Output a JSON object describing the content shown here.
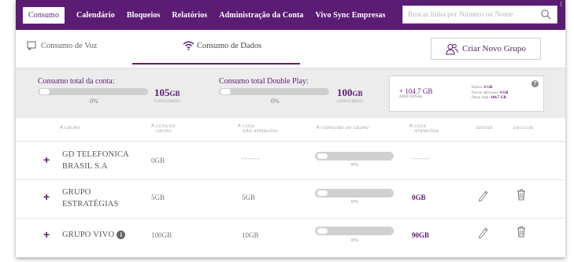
{
  "nav": {
    "items": [
      {
        "label": "Consumo",
        "active": true
      },
      {
        "label": "Calendário"
      },
      {
        "label": "Bloqueios"
      },
      {
        "label": "Relatórios"
      },
      {
        "label": "Administração da Conta"
      },
      {
        "label": "Vivo Sync Empresas"
      }
    ],
    "search_placeholder": "Buscar linha por Número ou Nome",
    "search_icon": "search-icon"
  },
  "tabs": {
    "voz": {
      "label": "Consumo de Voz",
      "icon": "chat-icon"
    },
    "dados": {
      "label": "Consumo de Dados",
      "icon": "wifi-icon",
      "active": true
    },
    "new_group": {
      "label": "Criar Novo Grupo",
      "icon": "users-icon"
    }
  },
  "summary": {
    "conta": {
      "title": "Consumo total da conta:",
      "percent": "0%",
      "fill": 0,
      "value": "105",
      "unit": "GB",
      "caption": "CONSUMIDO"
    },
    "double_play": {
      "title": "Consumo total Double Play:",
      "percent": "0%",
      "fill": 0,
      "value": "100",
      "unit": "GB",
      "caption": "CONSUMIDO"
    },
    "adicional": {
      "value": "+ 104.7 GB",
      "caption": "ADICIONAL"
    },
    "details": [
      {
        "label": "Bônus:",
        "value": "0 GB"
      },
      {
        "label": "Pacote adicional:",
        "value": "4 GB"
      },
      {
        "label": "Plano total:",
        "value": "104.7 GB"
      }
    ]
  },
  "table": {
    "headers": {
      "grupo": "GRUPO",
      "cota_grupo": [
        "COTA DO",
        "GRUPO"
      ],
      "cota_nao": [
        "COTA",
        "NÃO ATRIBUÍDA"
      ],
      "consumo": "CONSUMO DO GRUPO",
      "cota_atrib": [
        "COTA",
        "ATRIBUÍDA"
      ],
      "editar": "EDITAR",
      "excluir": "EXCLUIR"
    },
    "rows": [
      {
        "name_line1": "GD TELEFONICA",
        "name_line2": "BRASIL S.A",
        "cota_grupo": "0GB",
        "cota_nao": "------",
        "consumo_pct": "0%",
        "consumo_fill": 0,
        "cota_atrib": "------"
      },
      {
        "name_line1": "GRUPO",
        "name_line2": "ESTRATÉGIAS",
        "cota_grupo": "5GB",
        "cota_nao": "5GB",
        "consumo_pct": "0%",
        "consumo_fill": 0,
        "cota_atrib": "0GB"
      },
      {
        "name_line1": "GRUPO VIVO",
        "name_line2": "",
        "cota_grupo": "100GB",
        "cota_nao": "10GB",
        "consumo_pct": "0%",
        "consumo_fill": 0,
        "cota_atrib": "90GB"
      }
    ]
  },
  "colors": {
    "brand": "#5a1d73",
    "nav_text": "#ffffff",
    "summary_bg": "#ececec"
  }
}
